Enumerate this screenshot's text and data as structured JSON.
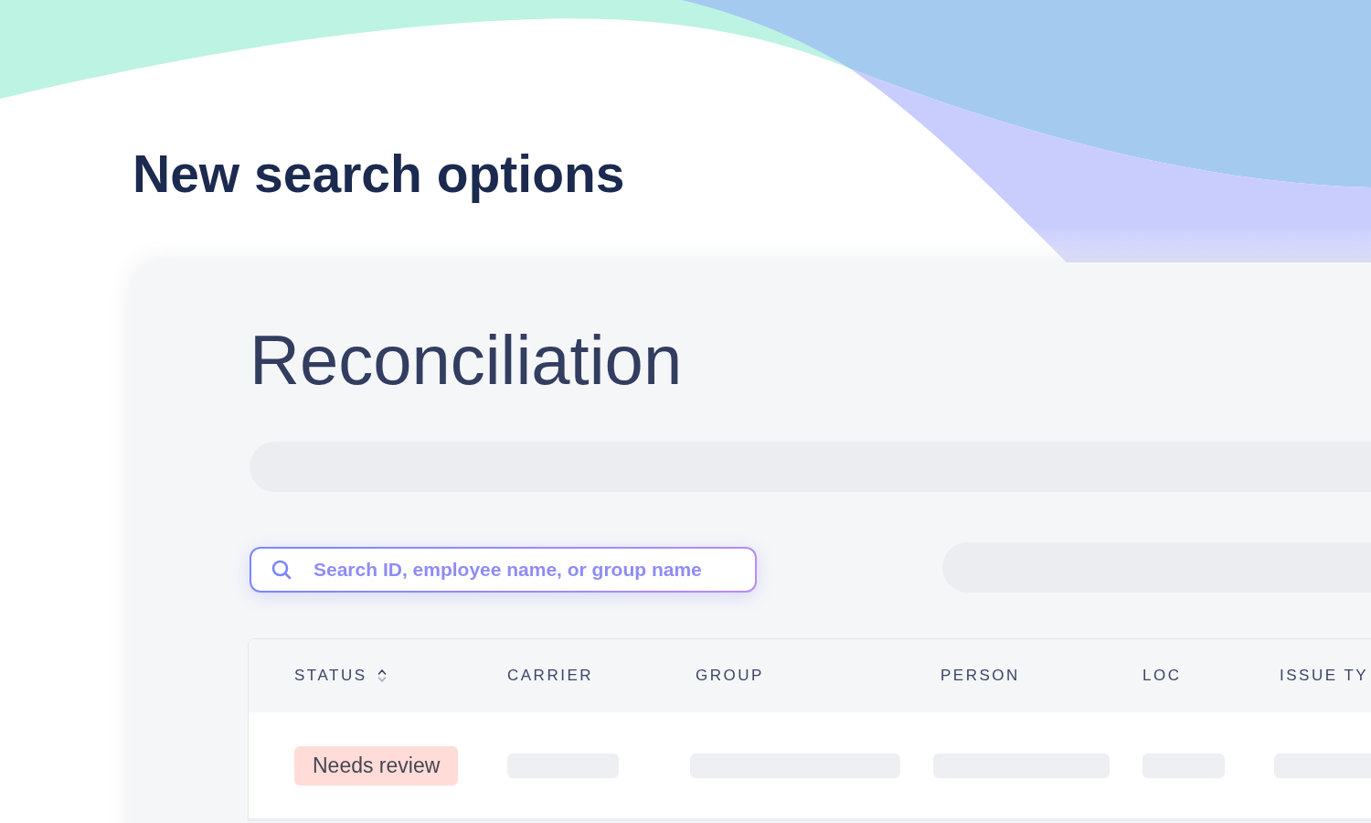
{
  "heading": "New search options",
  "panel": {
    "title": "Reconciliation",
    "search": {
      "placeholder": "Search ID, employee name, or group name"
    }
  },
  "table": {
    "columns": [
      {
        "label": "STATUS",
        "sortable": true
      },
      {
        "label": "CARRIER",
        "sortable": false
      },
      {
        "label": "GROUP",
        "sortable": false
      },
      {
        "label": "PERSON",
        "sortable": false
      },
      {
        "label": "LOC",
        "sortable": false
      },
      {
        "label": "ISSUE TY",
        "sortable": false
      }
    ],
    "rows": [
      {
        "cells": [
          {
            "kind": "badge",
            "text": "Needs review"
          },
          {
            "kind": "skeleton"
          },
          {
            "kind": "skeleton"
          },
          {
            "kind": "skeleton"
          },
          {
            "kind": "skeleton"
          },
          {
            "kind": "skeleton"
          }
        ]
      }
    ]
  }
}
